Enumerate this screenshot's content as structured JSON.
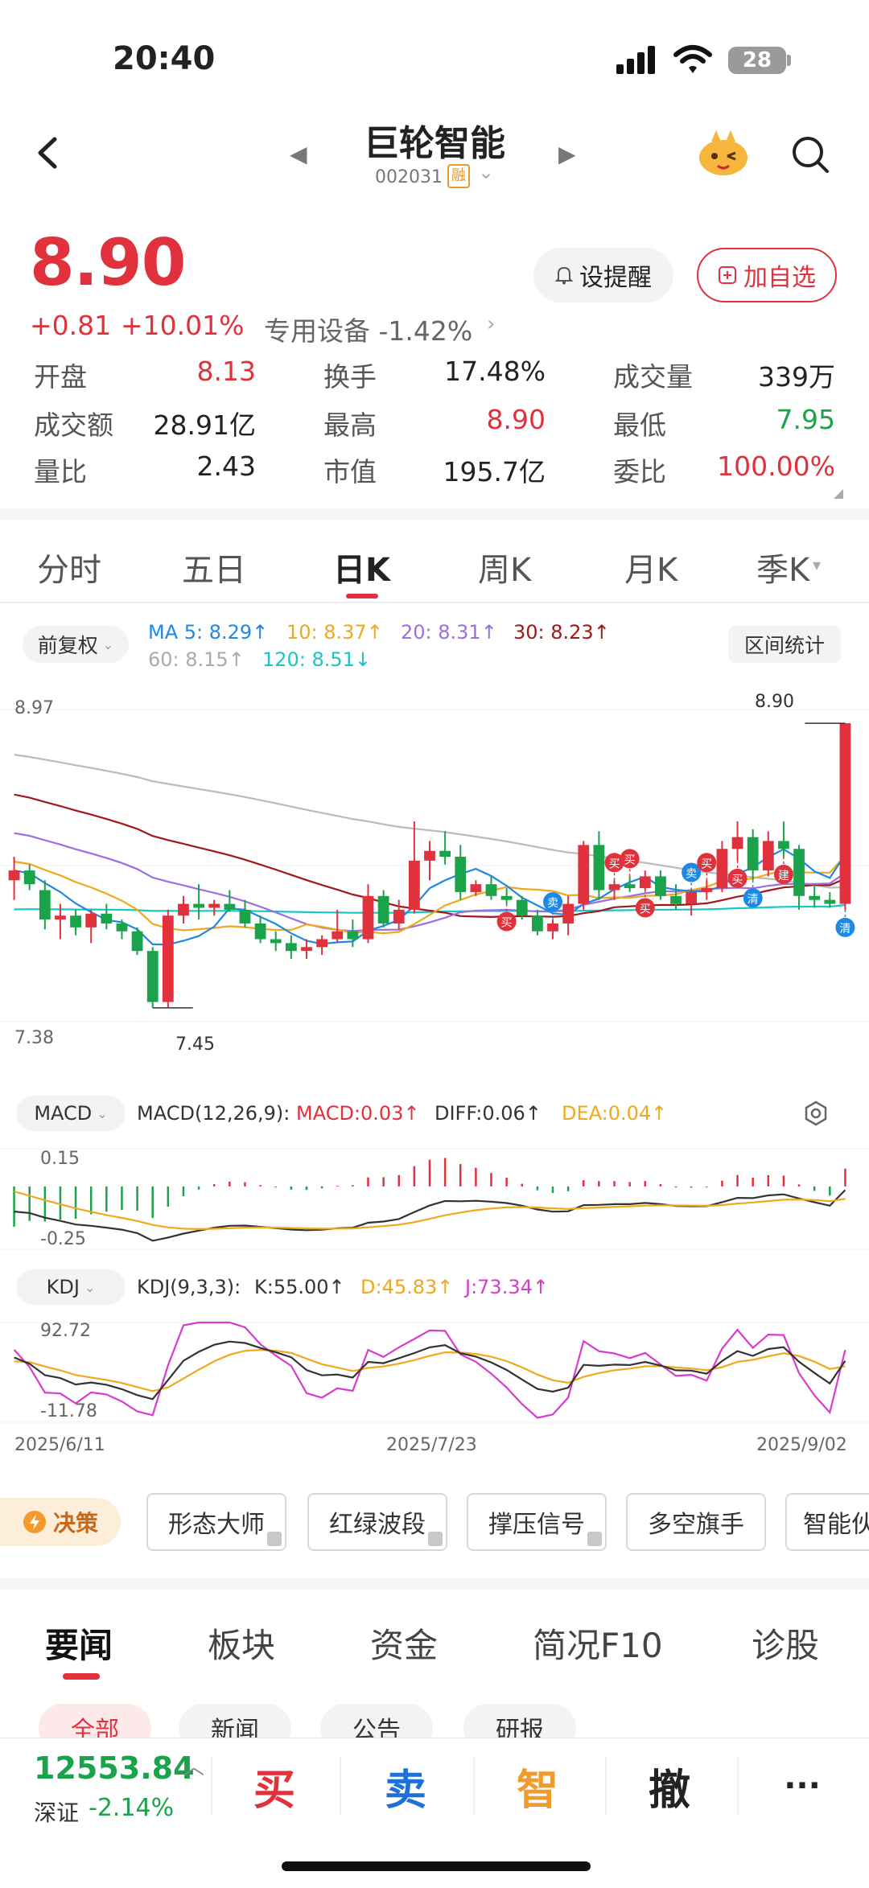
{
  "status": {
    "time": "20:40",
    "battery": "28"
  },
  "header": {
    "name": "巨轮智能",
    "code": "002031",
    "margin_badge": "融"
  },
  "quote": {
    "price": "8.90",
    "change_abs": "+0.81",
    "change_pct": "+10.01%",
    "sector": "专用设备 -1.42%",
    "alert_label": "设提醒",
    "watch_label": "加自选",
    "stats": [
      [
        {
          "label": "开盘",
          "value": "8.13",
          "color": "red"
        },
        {
          "label": "换手",
          "value": "17.48%",
          "color": "black"
        },
        {
          "label": "成交量",
          "value": "339万",
          "color": "black"
        }
      ],
      [
        {
          "label": "成交额",
          "value": "28.91亿",
          "color": "black"
        },
        {
          "label": "最高",
          "value": "8.90",
          "color": "red"
        },
        {
          "label": "最低",
          "value": "7.95",
          "color": "green"
        }
      ],
      [
        {
          "label": "量比",
          "value": "2.43",
          "color": "black"
        },
        {
          "label": "市值",
          "value": "195.7亿",
          "color": "black"
        },
        {
          "label": "委比",
          "value": "100.00%",
          "color": "red"
        }
      ]
    ]
  },
  "period_tabs": [
    "分时",
    "五日",
    "日K",
    "周K",
    "月K",
    "季K"
  ],
  "chart": {
    "adjust_label": "前复权",
    "range_label": "区间统计",
    "ma": [
      {
        "text": "MA 5: 8.29↑",
        "color": "#1e88e5"
      },
      {
        "text": "10: 8.37↑",
        "color": "#f0a81c"
      },
      {
        "text": "20: 8.31↑",
        "color": "#9c6ee0"
      },
      {
        "text": "30: 8.23↑",
        "color": "#a01818"
      },
      {
        "text": "60: 8.15↑",
        "color": "#aaaaaa"
      },
      {
        "text": "120: 8.51↓",
        "color": "#18c6c6"
      }
    ],
    "y_top": "8.97",
    "y_bottom": "7.38",
    "max_label": "8.90",
    "min_label": "7.45",
    "macd": {
      "button": "MACD",
      "params": "MACD(12,26,9):",
      "macd": "MACD:0.03↑",
      "diff": "DIFF:0.06↑",
      "dea": "DEA:0.04↑",
      "y_top": "0.15",
      "y_bottom": "-0.25"
    },
    "kdj": {
      "button": "KDJ",
      "params": "KDJ(9,3,3):",
      "k": "K:55.00↑",
      "d": "D:45.83↑",
      "j": "J:73.34↑",
      "y_top": "92.72",
      "y_bottom": "-11.78"
    },
    "dates": [
      "2025/6/11",
      "2025/7/23",
      "2025/9/02"
    ],
    "signals": {
      "buy": "买",
      "sell": "卖",
      "build": "建",
      "clear": "清"
    }
  },
  "chart_data": {
    "type": "candlestick",
    "title": "巨轮智能 日K",
    "x_labels": [
      "2025/6/11",
      "2025/7/23",
      "2025/9/02"
    ],
    "y_range": [
      7.38,
      8.97
    ],
    "ohlc": [
      [
        8.1,
        8.22,
        8.0,
        8.15
      ],
      [
        8.15,
        8.18,
        8.05,
        8.08
      ],
      [
        8.05,
        8.1,
        7.85,
        7.9
      ],
      [
        7.9,
        7.98,
        7.8,
        7.92
      ],
      [
        7.92,
        7.95,
        7.82,
        7.86
      ],
      [
        7.86,
        7.95,
        7.78,
        7.93
      ],
      [
        7.93,
        7.98,
        7.85,
        7.88
      ],
      [
        7.88,
        7.9,
        7.8,
        7.84
      ],
      [
        7.84,
        7.86,
        7.72,
        7.74
      ],
      [
        7.74,
        7.76,
        7.45,
        7.48
      ],
      [
        7.48,
        7.95,
        7.45,
        7.92
      ],
      [
        7.92,
        8.02,
        7.88,
        7.98
      ],
      [
        7.98,
        8.08,
        7.9,
        7.96
      ],
      [
        7.96,
        8.0,
        7.92,
        7.98
      ],
      [
        7.98,
        8.05,
        7.94,
        7.95
      ],
      [
        7.95,
        8.0,
        7.86,
        7.88
      ],
      [
        7.88,
        7.92,
        7.78,
        7.8
      ],
      [
        7.8,
        7.84,
        7.74,
        7.78
      ],
      [
        7.78,
        7.82,
        7.7,
        7.74
      ],
      [
        7.74,
        7.8,
        7.7,
        7.76
      ],
      [
        7.76,
        7.82,
        7.72,
        7.8
      ],
      [
        7.8,
        7.95,
        7.78,
        7.84
      ],
      [
        7.84,
        7.9,
        7.76,
        7.8
      ],
      [
        7.8,
        8.08,
        7.78,
        8.02
      ],
      [
        8.02,
        8.05,
        7.86,
        7.88
      ],
      [
        7.88,
        8.0,
        7.85,
        7.95
      ],
      [
        7.95,
        8.4,
        7.93,
        8.2
      ],
      [
        8.2,
        8.3,
        8.1,
        8.25
      ],
      [
        8.25,
        8.35,
        8.18,
        8.22
      ],
      [
        8.22,
        8.28,
        8.0,
        8.04
      ],
      [
        8.04,
        8.1,
        8.02,
        8.08
      ],
      [
        8.08,
        8.12,
        8.0,
        8.02
      ],
      [
        8.02,
        8.06,
        7.98,
        8.0
      ],
      [
        8.0,
        8.02,
        7.9,
        7.92
      ],
      [
        7.92,
        7.95,
        7.82,
        7.84
      ],
      [
        7.84,
        7.9,
        7.8,
        7.88
      ],
      [
        7.88,
        8.02,
        7.82,
        7.98
      ],
      [
        7.98,
        8.3,
        7.95,
        8.28
      ],
      [
        8.28,
        8.35,
        8.0,
        8.05
      ],
      [
        8.05,
        8.1,
        8.0,
        8.08
      ],
      [
        8.08,
        8.12,
        8.04,
        8.06
      ],
      [
        8.06,
        8.15,
        8.05,
        8.12
      ],
      [
        8.12,
        8.15,
        8.0,
        8.02
      ],
      [
        8.02,
        8.08,
        7.95,
        7.98
      ],
      [
        7.98,
        8.05,
        7.92,
        8.04
      ],
      [
        8.04,
        8.1,
        8.0,
        8.06
      ],
      [
        8.06,
        8.3,
        8.04,
        8.26
      ],
      [
        8.26,
        8.4,
        8.2,
        8.32
      ],
      [
        8.32,
        8.36,
        8.1,
        8.15
      ],
      [
        8.15,
        8.35,
        8.12,
        8.3
      ],
      [
        8.3,
        8.4,
        8.22,
        8.26
      ],
      [
        8.26,
        8.28,
        7.95,
        8.02
      ],
      [
        8.02,
        8.08,
        7.96,
        8.0
      ],
      [
        8.0,
        8.04,
        7.96,
        7.98
      ],
      [
        7.98,
        8.9,
        7.95,
        8.9
      ]
    ],
    "ma_lines": {
      "MA5": "8.29",
      "MA10": "8.37",
      "MA20": "8.31",
      "MA30": "8.23",
      "MA60": "8.15",
      "MA120": "8.51"
    },
    "macd": {
      "MACD": 0.03,
      "DIFF": 0.06,
      "DEA": 0.04,
      "ylim": [
        -0.25,
        0.15
      ]
    },
    "kdj": {
      "K": 55.0,
      "D": 45.83,
      "J": 73.34,
      "ylim": [
        -11.78,
        92.72
      ]
    }
  },
  "strategy": {
    "badge": "决策",
    "chips": [
      "形态大师",
      "红绿波段",
      "撑压信号",
      "多空旗手",
      "智能伙"
    ]
  },
  "news_tabs": [
    "要闻",
    "板块",
    "资金",
    "简况F10",
    "诊股"
  ],
  "news_filters": [
    "全部",
    "新闻",
    "公告",
    "研报"
  ],
  "bottom_bar": {
    "index_value": "12553.84",
    "index_name": "深证",
    "index_pct": "-2.14%",
    "buy": "买",
    "sell": "卖",
    "smart": "智",
    "cancel": "撤",
    "more": "···"
  },
  "colors": {
    "up": "#e0313c",
    "down": "#1aa34a",
    "accent": "#e0313c"
  }
}
